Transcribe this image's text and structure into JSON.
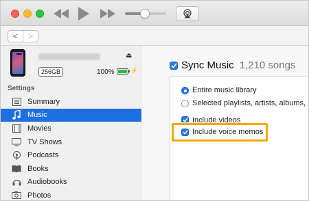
{
  "toolbar": {
    "icons": [
      "rewind-icon",
      "play-icon",
      "fast-forward-icon",
      "volume-icon",
      "airplay-icon"
    ],
    "volume_level": 0.48
  },
  "navigation": {
    "back": "<",
    "forward": ">"
  },
  "device": {
    "icon": "iphone-icon",
    "eject_symbol": "⏏",
    "capacity": "256GB",
    "battery_percent": "100%",
    "battery_level": 1.0,
    "battery_color": "#2fb84a"
  },
  "sidebar": {
    "section_label": "Settings",
    "active_color": "#1e6fe0",
    "items": [
      {
        "label": "Summary",
        "icon": "summary-icon"
      },
      {
        "label": "Music",
        "icon": "music-note-icon",
        "active": true
      },
      {
        "label": "Movies",
        "icon": "movies-icon"
      },
      {
        "label": "TV Shows",
        "icon": "tv-icon"
      },
      {
        "label": "Podcasts",
        "icon": "podcasts-icon"
      },
      {
        "label": "Books",
        "icon": "books-icon"
      },
      {
        "label": "Audiobooks",
        "icon": "audiobooks-icon"
      },
      {
        "label": "Photos",
        "icon": "photos-icon"
      }
    ]
  },
  "main": {
    "sync_label": "Sync Music",
    "sync_checked": true,
    "song_count": "1,210 songs",
    "options": {
      "entire_library": "Entire music library",
      "selected": "Selected playlists, artists, albums,",
      "include_videos": "Include videos",
      "include_voice_memos": "Include voice memos"
    },
    "highlight_color": "#f5a800"
  }
}
